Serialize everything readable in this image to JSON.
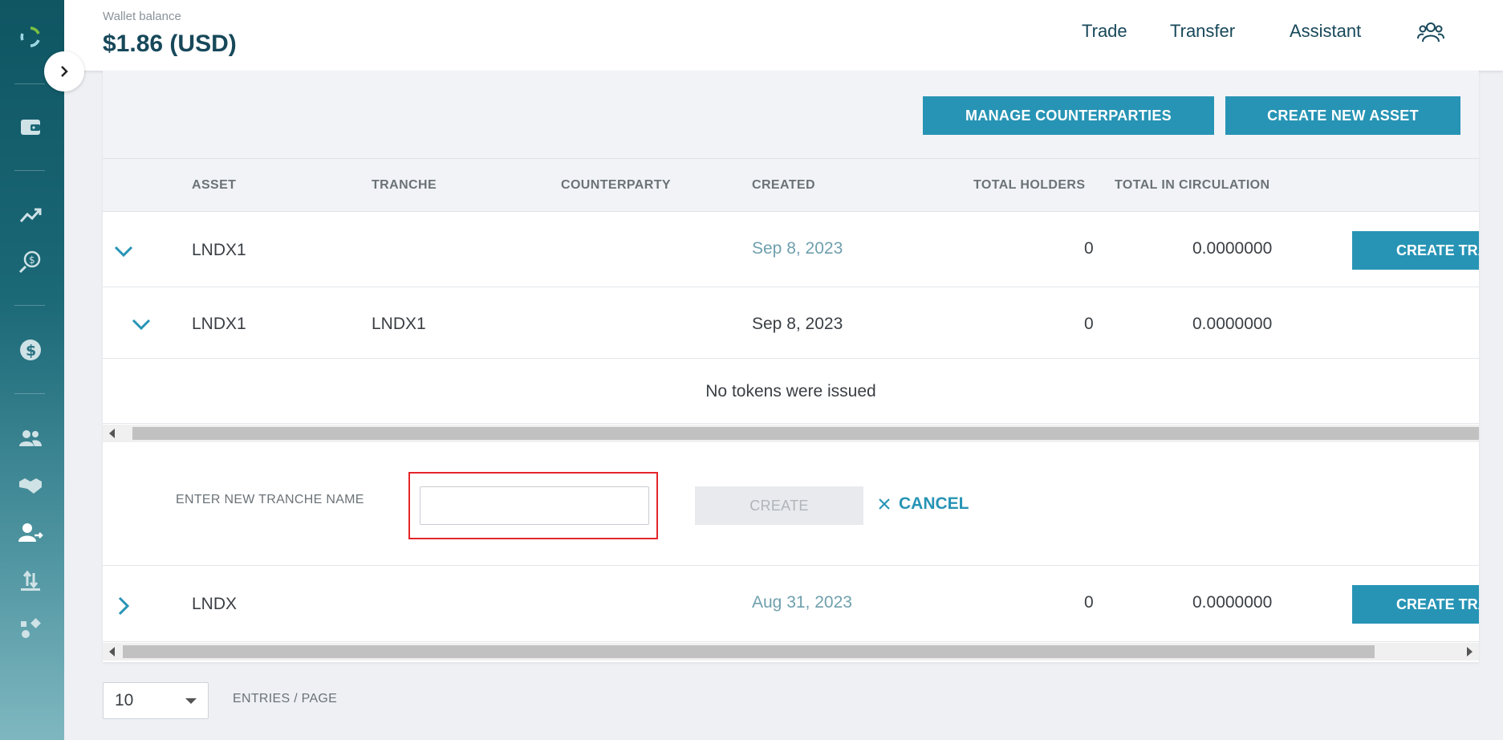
{
  "header": {
    "wallet_label": "Wallet balance",
    "wallet_value": "$1.86 (USD)",
    "nav": {
      "trade": "Trade",
      "transfer": "Transfer",
      "assistant": "Assistant"
    }
  },
  "toolbar": {
    "manage_counterparties": "MANAGE COUNTERPARTIES",
    "create_new_asset": "CREATE NEW ASSET"
  },
  "table": {
    "columns": {
      "asset": "ASSET",
      "tranche": "TRANCHE",
      "counterparty": "COUNTERPARTY",
      "created": "CREATED",
      "total_holders": "TOTAL HOLDERS",
      "total_in_circulation": "TOTAL IN CIRCULATION"
    },
    "rows": [
      {
        "asset": "LNDX1",
        "tranche": "",
        "created": "Sep 8, 2023",
        "holders": "0",
        "circulation": "0.0000000",
        "action": "CREATE TRANCHE"
      },
      {
        "asset": "LNDX1",
        "tranche": "LNDX1",
        "created": "Sep 8, 2023",
        "holders": "0",
        "circulation": "0.0000000"
      },
      {
        "asset": "LNDX",
        "tranche": "",
        "created": "Aug 31, 2023",
        "holders": "0",
        "circulation": "0.0000000",
        "action": "CREATE TRANCHE"
      }
    ],
    "empty_message": "No tokens were issued"
  },
  "tranche_form": {
    "label": "ENTER NEW TRANCHE NAME",
    "input_value": "",
    "create_label": "CREATE",
    "cancel_label": "CANCEL"
  },
  "pagination": {
    "entries_value": "10",
    "entries_label": "ENTRIES / PAGE"
  }
}
